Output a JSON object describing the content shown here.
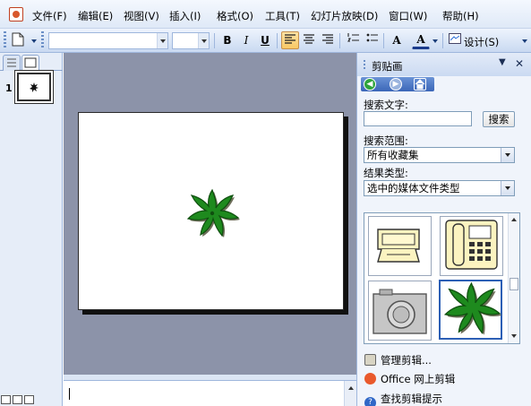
{
  "menu": {
    "items": [
      "文件(F)",
      "编辑(E)",
      "视图(V)",
      "插入(I)",
      "格式(O)",
      "工具(T)",
      "幻灯片放映(D)",
      "窗口(W)",
      "帮助(H)"
    ]
  },
  "toolbar": {
    "bold": "B",
    "italic": "I",
    "underline": "U",
    "font_size_up": "A",
    "font_color": "A",
    "design_label": "设计(S)"
  },
  "slides": {
    "number": "1"
  },
  "task_pane": {
    "title": "剪贴画",
    "search_label": "搜索文字:",
    "search_value": "",
    "search_button": "搜索",
    "scope_label": "搜索范围:",
    "scope_value": "所有收藏集",
    "type_label": "结果类型:",
    "type_value": "选中的媒体文件类型",
    "links": [
      "管理剪辑...",
      "Office 网上剪辑",
      "查找剪辑提示"
    ]
  },
  "icons": {
    "app": "powerpoint-icon",
    "back": "back-arrow-icon",
    "forward": "forward-arrow-icon",
    "home": "home-icon"
  },
  "colors": {
    "leaf": "#1e8a1e",
    "editor_bg": "#8c93a9",
    "toolbar_active": "#f8c864"
  }
}
